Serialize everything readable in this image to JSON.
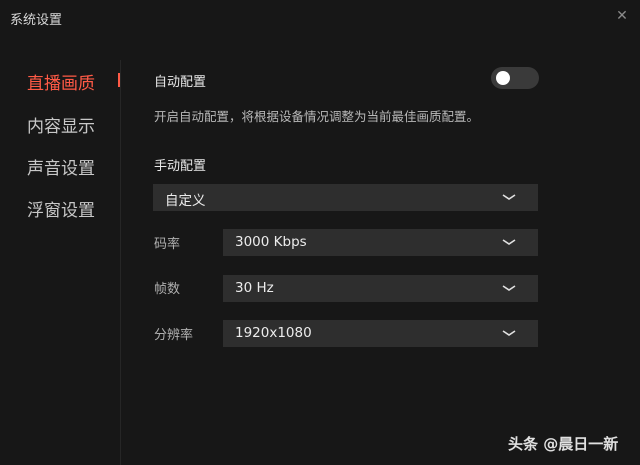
{
  "window": {
    "title": "系统设置"
  },
  "sidebar": {
    "items": [
      {
        "label": "直播画质",
        "active": true
      },
      {
        "label": "内容显示",
        "active": false
      },
      {
        "label": "声音设置",
        "active": false
      },
      {
        "label": "浮窗设置",
        "active": false
      }
    ]
  },
  "auto_config": {
    "label": "自动配置",
    "enabled": false,
    "description": "开启自动配置，将根据设备情况调整为当前最佳画质配置。"
  },
  "manual_config": {
    "label": "手动配置",
    "preset": "自定义",
    "bitrate": {
      "label": "码率",
      "value": "3000 Kbps"
    },
    "framerate": {
      "label": "帧数",
      "value": "30 Hz"
    },
    "resolution": {
      "label": "分辨率",
      "value": "1920x1080"
    }
  },
  "watermark": "头条 @晨日一新",
  "colors": {
    "accent": "#ff5a46",
    "background": "#171717",
    "control": "#2e2e2e"
  }
}
